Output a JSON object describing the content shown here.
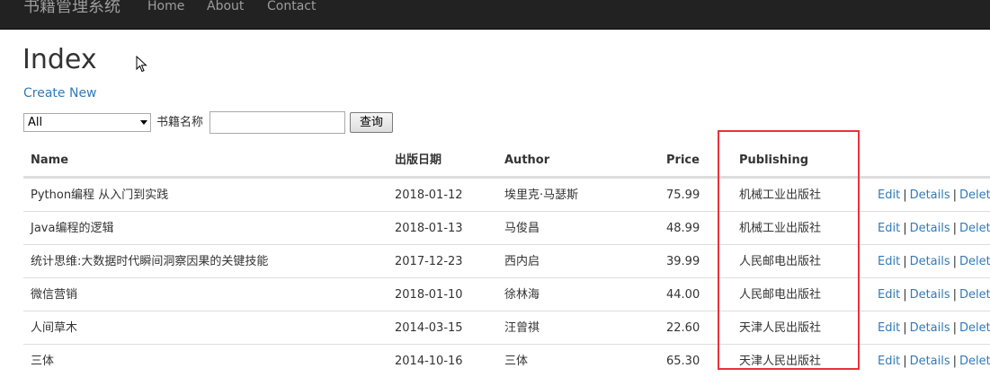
{
  "navbar": {
    "brand": "书籍管理系统",
    "links": [
      "Home",
      "About",
      "Contact"
    ]
  },
  "page": {
    "title": "Index",
    "create_link": "Create New"
  },
  "search": {
    "filter_selected": "All",
    "label": "书籍名称",
    "input_value": "",
    "button_label": "查询"
  },
  "table": {
    "headers": [
      "Name",
      "出版日期",
      "Author",
      "Price",
      "Publishing"
    ],
    "rows": [
      {
        "name": "Python编程 从入门到实践",
        "date": "2018-01-12",
        "author": "埃里克·马瑟斯",
        "price": "75.99",
        "publishing": "机械工业出版社"
      },
      {
        "name": "Java编程的逻辑",
        "date": "2018-01-13",
        "author": "马俊昌",
        "price": "48.99",
        "publishing": "机械工业出版社"
      },
      {
        "name": "统计思维:大数据时代瞬间洞察因果的关键技能",
        "date": "2017-12-23",
        "author": "西内启",
        "price": "39.99",
        "publishing": "人民邮电出版社"
      },
      {
        "name": "微信营销",
        "date": "2018-01-10",
        "author": "徐林海",
        "price": "44.00",
        "publishing": "人民邮电出版社"
      },
      {
        "name": "人间草木",
        "date": "2014-03-15",
        "author": "汪曾祺",
        "price": "22.60",
        "publishing": "天津人民出版社"
      },
      {
        "name": "三体",
        "date": "2014-10-16",
        "author": "三体",
        "price": "65.30",
        "publishing": "天津人民出版社"
      }
    ],
    "actions": {
      "edit": "Edit",
      "details": "Details",
      "delete": "Delete",
      "separator": "|"
    }
  },
  "colors": {
    "navbar_bg": "#222222",
    "nav_text": "#9d9d9d",
    "link": "#337ab7",
    "highlight": "#e8323c"
  }
}
